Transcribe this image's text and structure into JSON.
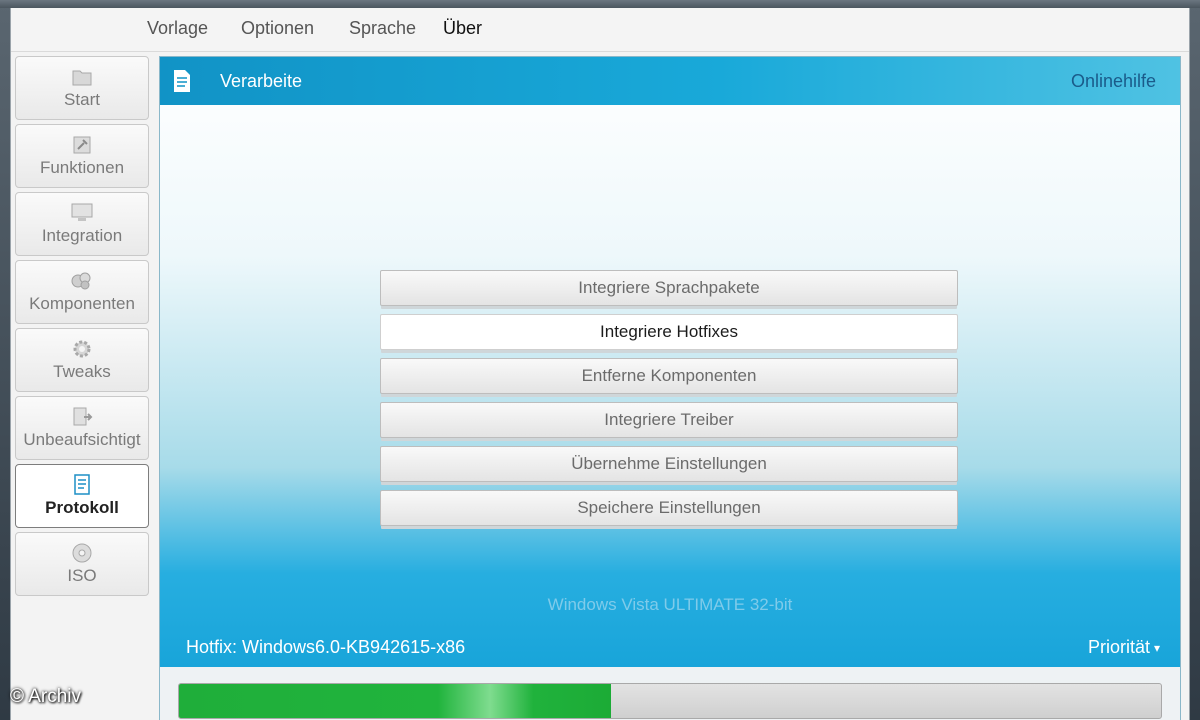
{
  "menu": {
    "items": [
      {
        "label": "Vorlage"
      },
      {
        "label": "Optionen"
      },
      {
        "label": "Sprache"
      },
      {
        "label": "Über"
      }
    ]
  },
  "sidebar": {
    "items": [
      {
        "label": "Start",
        "icon": "folder-icon"
      },
      {
        "label": "Funktionen",
        "icon": "tool-icon"
      },
      {
        "label": "Integration",
        "icon": "monitor-icon"
      },
      {
        "label": "Komponenten",
        "icon": "components-icon"
      },
      {
        "label": "Tweaks",
        "icon": "gear-icon"
      },
      {
        "label": "Unbeaufsichtigt",
        "icon": "document-arrow-icon"
      },
      {
        "label": "Protokoll",
        "icon": "document-icon"
      },
      {
        "label": "ISO",
        "icon": "disc-icon"
      }
    ],
    "active": "Protokoll"
  },
  "main": {
    "header": {
      "title": "Verarbeite",
      "help_link": "Onlinehilfe",
      "icon": "document-icon"
    },
    "actions": [
      {
        "label": "Integriere Sprachpakete"
      },
      {
        "label": "Integriere Hotfixes"
      },
      {
        "label": "Entferne Komponenten"
      },
      {
        "label": "Integriere Treiber"
      },
      {
        "label": "Übernehme Einstellungen"
      },
      {
        "label": "Speichere Einstellungen"
      }
    ],
    "active_action": "Integriere Hotfixes",
    "os_label": "Windows Vista ULTIMATE 32-bit",
    "status": "Hotfix: Windows6.0-KB942615-x86",
    "priority": "Priorität",
    "progress": 0.44
  },
  "watermark": "© Archiv",
  "colors": {
    "header_blue": "#1193c6",
    "help_link": "#1a5b8a",
    "progress_green": "#1fae3a"
  }
}
